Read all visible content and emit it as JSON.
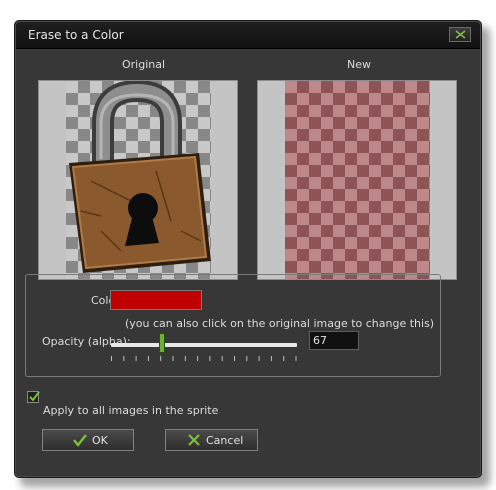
{
  "window": {
    "title": "Erase to a Color"
  },
  "previews": {
    "original_label": "Original",
    "new_label": "New"
  },
  "color": {
    "label": "Color:",
    "value": "#C00000",
    "hint": "(you can also click on the original image to change this)"
  },
  "opacity": {
    "label": "Opacity (alpha):",
    "value": "67",
    "slider_fraction": 0.27
  },
  "apply_all": {
    "label": "Apply to all images in the sprite",
    "checked": true
  },
  "buttons": {
    "ok": "OK",
    "cancel": "Cancel"
  },
  "icons": {
    "close": "close-x-icon",
    "ok": "checkmark-icon",
    "cancel": "cross-icon",
    "original_image": "padlock-icon"
  },
  "colors": {
    "accent_green": "#6FB12A",
    "background": "#373737",
    "title_bar": "#151515"
  }
}
